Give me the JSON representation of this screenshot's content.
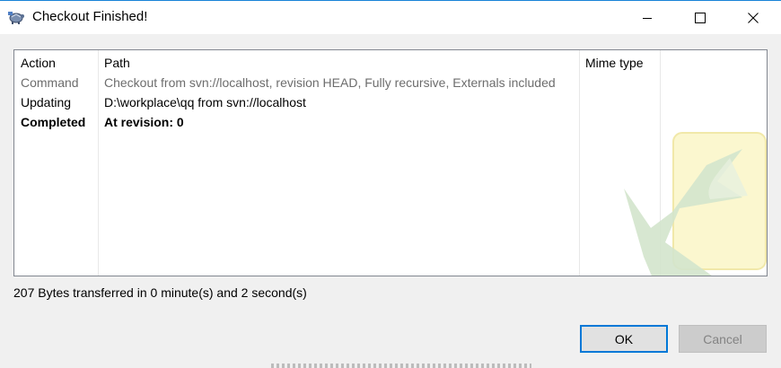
{
  "window": {
    "title": "Checkout Finished!",
    "app_icon": "tortoise-icon",
    "controls": [
      "minimize-icon",
      "maximize-icon",
      "close-icon"
    ]
  },
  "list": {
    "columns": [
      "Action",
      "Path",
      "Mime type"
    ],
    "rows": [
      {
        "action": "Command",
        "path": "Checkout from svn://localhost, revision HEAD, Fully recursive, Externals included",
        "style": "gray"
      },
      {
        "action": "Updating",
        "path": "D:\\workplace\\qq from svn://localhost",
        "style": "normal"
      },
      {
        "action": "Completed",
        "path": "At revision: 0",
        "style": "bold"
      }
    ]
  },
  "status": "207 Bytes transferred in 0 minute(s) and 2 second(s)",
  "buttons": {
    "ok": "OK",
    "cancel": "Cancel"
  },
  "colors": {
    "title_border": "#1883d7",
    "ok_focus_border": "#0078d7",
    "command_text": "#6d6d6d"
  }
}
